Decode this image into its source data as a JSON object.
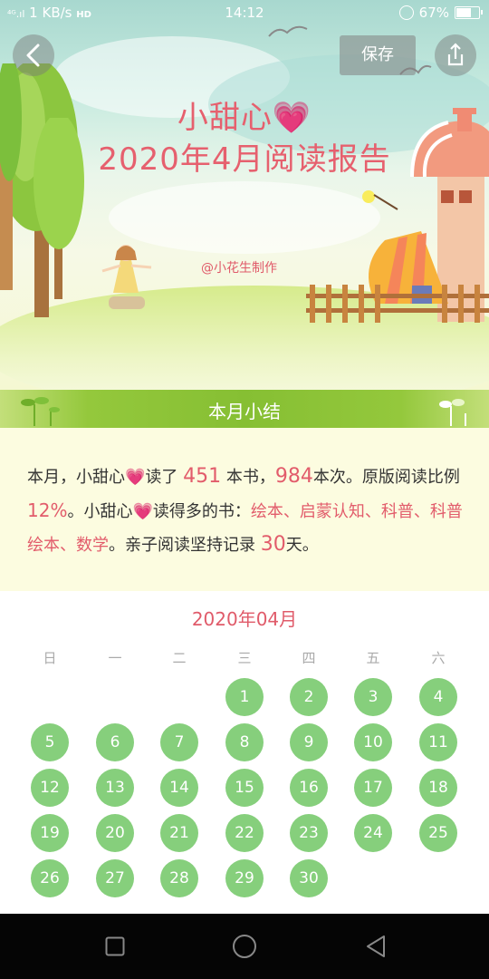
{
  "status_bar": {
    "signal": "⁴ᴳ.ıl",
    "speed": "1 KB/s",
    "hd": "HD",
    "time": "14:12",
    "battery": "67%",
    "battery_level": 0.67
  },
  "header": {
    "title_line1": "小甜心",
    "title_line2": "2020年4月阅读报告",
    "credit": "@小花生制作",
    "save_label": "保存",
    "heart_emoji": "💗"
  },
  "summary": {
    "section_title": "本月小结",
    "t1": "本月，小甜心",
    "t2": "读了 ",
    "books": "451",
    "t3": " 本书，",
    "times": "984",
    "t4": "本次。原版阅读比例",
    "ratio": "12%",
    "t5": "。小甜心",
    "t6": "读得多的书：",
    "categories": "绘本、启蒙认知、科普、科普绘本、数学",
    "t7": "。亲子阅读坚持记录 ",
    "days": "30",
    "t8": "天。"
  },
  "calendar": {
    "title": "2020年04月",
    "weekdays": [
      "日",
      "一",
      "二",
      "三",
      "四",
      "五",
      "六"
    ],
    "first_weekday": 3,
    "days": [
      1,
      2,
      3,
      4,
      5,
      6,
      7,
      8,
      9,
      10,
      11,
      12,
      13,
      14,
      15,
      16,
      17,
      18,
      19,
      20,
      21,
      22,
      23,
      24,
      25,
      26,
      27,
      28,
      29,
      30
    ]
  },
  "colors": {
    "accent_pink": "#e25c6b",
    "day_green": "#86cf7c",
    "band_green": "#86bf33"
  }
}
